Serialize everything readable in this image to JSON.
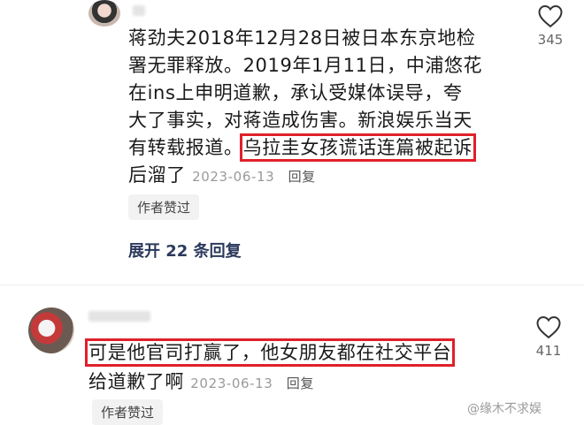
{
  "comments": [
    {
      "text_lines": [
        "蒋劲夫2018年12月28日被日本东京地检",
        "署无罪释放。2019年1月11日，中浦悠花",
        "在ins上申明道歉，承认受媒体误导，夸",
        "大了事实，对蒋造成伤害。新浪娱乐当天",
        "有转载报道。"
      ],
      "highlight": "乌拉圭女孩谎话连篇被起诉",
      "tail": "后溜了",
      "date": "2023-06-13",
      "reply_label": "回复",
      "badge": "作者赞过",
      "likes": "345",
      "expand_label": "展开 22 条回复"
    },
    {
      "highlight": "可是他官司打赢了，他女朋友都在社交平台",
      "tail": "给道歉了啊",
      "date": "2023-06-13",
      "reply_label": "回复",
      "badge": "作者赞过",
      "likes": "411"
    }
  ],
  "watermark": "@缘木不求娱",
  "colors": {
    "highlight_border": "#e0202a",
    "expand_text": "#2b3a5c"
  }
}
